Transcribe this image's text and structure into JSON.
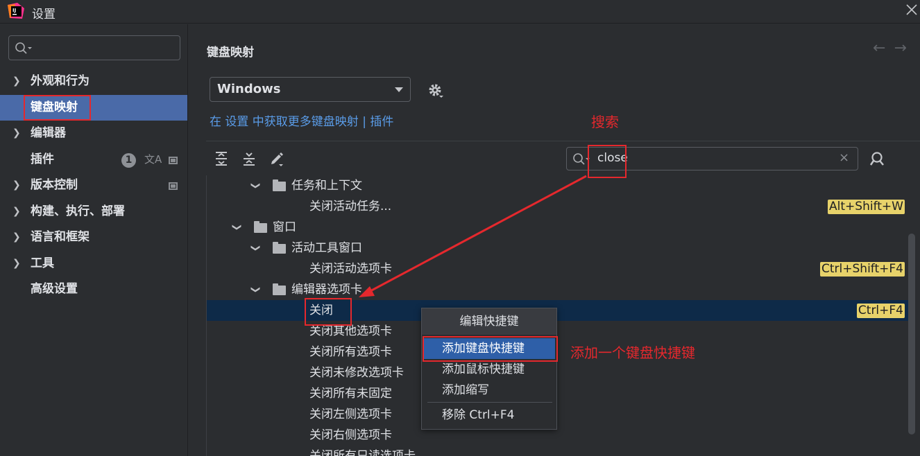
{
  "window": {
    "title": "设置",
    "icon": "intellij-app-icon",
    "close_icon": "close-icon"
  },
  "sidebar": {
    "search": {
      "value": "",
      "placeholder": ""
    },
    "items": [
      {
        "label": "外观和行为",
        "expandable": true
      },
      {
        "label": "键盘映射",
        "expandable": false,
        "active": true
      },
      {
        "label": "编辑器",
        "expandable": true
      },
      {
        "label": "插件",
        "expandable": false,
        "badge": "1"
      },
      {
        "label": "版本控制",
        "expandable": true
      },
      {
        "label": "构建、执行、部署",
        "expandable": true
      },
      {
        "label": "语言和框架",
        "expandable": true
      },
      {
        "label": "工具",
        "expandable": true
      },
      {
        "label": "高级设置",
        "expandable": false
      }
    ]
  },
  "main": {
    "title": "键盘映射",
    "scheme": "Windows",
    "get_more_link": "在 设置 中获取更多键盘映射 | 插件",
    "search": {
      "value": "close"
    },
    "tree": [
      {
        "label": "任务和上下文",
        "type": "folder",
        "level": 2,
        "expanded": true
      },
      {
        "label": "关闭活动任务...",
        "type": "action",
        "level": 3,
        "shortcut": "Alt+Shift+W"
      },
      {
        "label": "窗口",
        "type": "folder",
        "level": 1,
        "expanded": true
      },
      {
        "label": "活动工具窗口",
        "type": "folder",
        "level": 2,
        "expanded": true
      },
      {
        "label": "关闭活动选项卡",
        "type": "action",
        "level": 3,
        "shortcut": "Ctrl+Shift+F4"
      },
      {
        "label": "编辑器选项卡",
        "type": "folder",
        "level": 2,
        "expanded": true
      },
      {
        "label": "关闭",
        "type": "action",
        "level": 3,
        "shortcut": "Ctrl+F4",
        "selected": true
      },
      {
        "label": "关闭其他选项卡",
        "type": "action",
        "level": 3
      },
      {
        "label": "关闭所有选项卡",
        "type": "action",
        "level": 3
      },
      {
        "label": "关闭未修改选项卡",
        "type": "action",
        "level": 3
      },
      {
        "label": "关闭所有未固定",
        "type": "action",
        "level": 3
      },
      {
        "label": "关闭左侧选项卡",
        "type": "action",
        "level": 3
      },
      {
        "label": "关闭右侧选项卡",
        "type": "action",
        "level": 3
      },
      {
        "label": "关闭所有只读选项卡",
        "type": "action",
        "level": 3
      }
    ]
  },
  "context_menu": {
    "title": "编辑快捷键",
    "items": [
      {
        "label": "添加键盘快捷键",
        "highlighted": true
      },
      {
        "label": "添加鼠标快捷键"
      },
      {
        "label": "添加缩写"
      },
      {
        "label": "移除 Ctrl+F4"
      }
    ]
  },
  "annotations": {
    "search_label": "搜索",
    "add_label": "添加一个键盘快捷键",
    "color": "#e5282d"
  },
  "colors": {
    "accent": "#4a6aa8",
    "selection": "#0e2a48",
    "shortcut_highlight": "#e7d26a",
    "link": "#5a9ce8"
  }
}
